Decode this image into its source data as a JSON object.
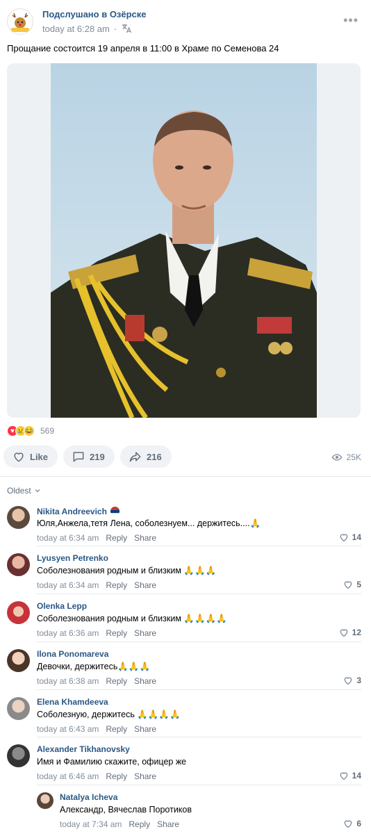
{
  "post": {
    "community": "Подслушано в Озёрске",
    "time": "today at 6:28 am",
    "separator": "·",
    "text": "Прощание состоится 19 апреля в 11:00 в Храме по Семенова 24",
    "reactions_count": "569",
    "views": "25K"
  },
  "actions": {
    "like_label": "Like",
    "comments_count": "219",
    "shares_count": "216"
  },
  "sort_label": "Oldest",
  "comments": [
    {
      "author": "Nikita Andreevich",
      "text": "Юля,Анжела,тетя Лена, соболезнуем... держитесь....🙏",
      "time": "today at 6:34 am",
      "reply": "Reply",
      "share": "Share",
      "likes": "14"
    },
    {
      "author": "Lyusyen Petrenko",
      "text": "Соболезнования родным и близким 🙏🙏🙏",
      "time": "today at 6:34 am",
      "reply": "Reply",
      "share": "Share",
      "likes": "5"
    },
    {
      "author": "Olenka Lepp",
      "text": "Соболезнования родным и близким 🙏🙏🙏🙏",
      "time": "today at 6:36 am",
      "reply": "Reply",
      "share": "Share",
      "likes": "12"
    },
    {
      "author": "Ilona Ponomareva",
      "text": "Девочки, держитесь🙏🙏🙏",
      "time": "today at 6:38 am",
      "reply": "Reply",
      "share": "Share",
      "likes": "3"
    },
    {
      "author": "Elena Khamdeeva",
      "text": "Соболезную, держитесь 🙏🙏🙏🙏",
      "time": "today at 6:43 am",
      "reply": "Reply",
      "share": "Share",
      "likes": ""
    },
    {
      "author": "Alexander Tikhanovsky",
      "text": "Имя и Фамилию скажите, офицер же",
      "time": "today at 6:46 am",
      "reply": "Reply",
      "share": "Share",
      "likes": "14"
    },
    {
      "author": "Natalya Icheva",
      "text": "Александр, Вячеслав Поротиков",
      "time": "today at 7:34 am",
      "reply": "Reply",
      "share": "Share",
      "likes": "6"
    }
  ],
  "colors": {
    "link": "#2a5885",
    "muted": "#818c99",
    "button_bg": "#f0f2f5"
  }
}
